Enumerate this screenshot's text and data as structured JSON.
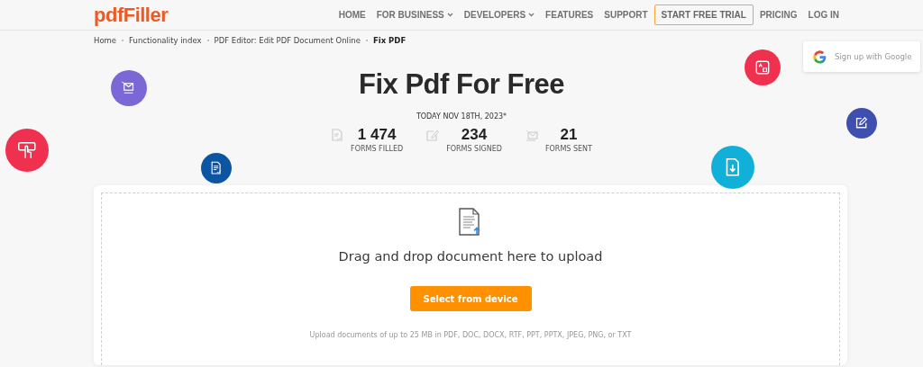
{
  "header": {
    "logo": "pdfFiller",
    "nav": [
      {
        "label": "HOME",
        "kind": "link"
      },
      {
        "label": "FOR BUSINESS",
        "kind": "dropdown"
      },
      {
        "label": "DEVELOPERS",
        "kind": "dropdown"
      },
      {
        "label": "FEATURES",
        "kind": "link"
      },
      {
        "label": "SUPPORT",
        "kind": "link"
      },
      {
        "label": "START FREE TRIAL",
        "kind": "outlined"
      },
      {
        "label": "PRICING",
        "kind": "link"
      },
      {
        "label": "LOG IN",
        "kind": "link"
      }
    ]
  },
  "breadcrumb": [
    {
      "label": "Home",
      "current": false
    },
    {
      "label": "Functionality index",
      "current": false
    },
    {
      "label": "PDF Editor: Edit PDF Document Online",
      "current": false
    },
    {
      "label": "Fix PDF",
      "current": true
    }
  ],
  "google_popup": {
    "label": "Sign up with Google"
  },
  "hero": {
    "title": "Fix Pdf For Free",
    "date": "TODAY NOV 18TH, 2023*",
    "stats": [
      {
        "kind": "filled",
        "value": "1 474",
        "label": "FORMS FILLED"
      },
      {
        "kind": "signed",
        "value": "234",
        "label": "FORMS SIGNED"
      },
      {
        "kind": "sent",
        "value": "21",
        "label": "FORMS SENT"
      }
    ]
  },
  "bubbles": [
    {
      "kind": "envelope",
      "color": "#7b68d6"
    },
    {
      "kind": "touch",
      "color": "#f0304f"
    },
    {
      "kind": "document",
      "color": "#0b55a3"
    },
    {
      "kind": "image",
      "color": "#f0304f"
    },
    {
      "kind": "edit",
      "color": "#3f4fb0"
    },
    {
      "kind": "download",
      "color": "#11b0d8"
    }
  ],
  "upload": {
    "prompt": "Drag and drop document here to upload",
    "button": "Select from device",
    "note": "Upload documents of up to 25 MB in PDF, DOC, DOCX, RTF, PPT, PPTX, JPEG, PNG, or TXT"
  }
}
